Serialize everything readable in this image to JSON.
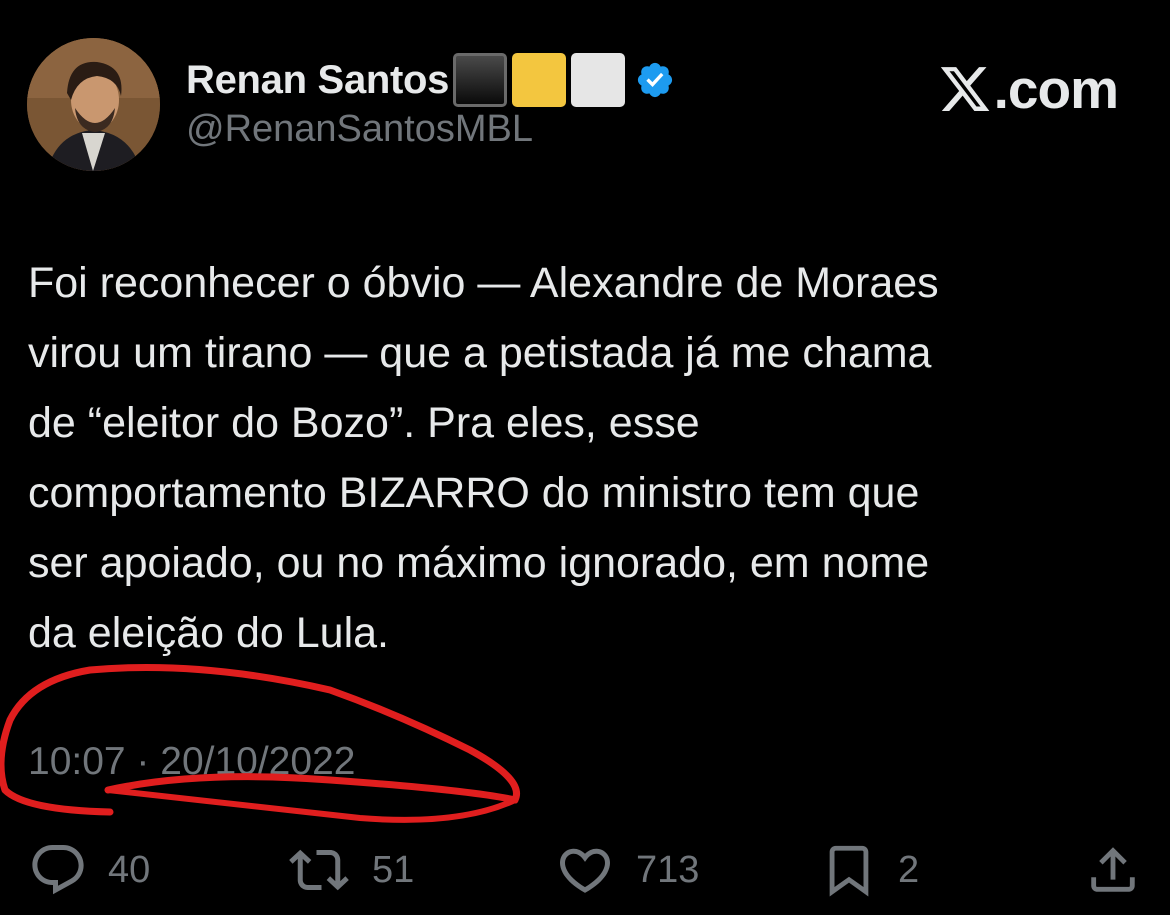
{
  "tweet": {
    "author_name": "Renan Santos",
    "author_handle": "@RenanSantosMBL",
    "name_emojis": [
      "black-square-emoji",
      "yellow-square-emoji",
      "white-square-emoji"
    ],
    "text_lines": [
      "Foi reconhecer o óbvio — Alexandre de Moraes",
      "virou um tirano — que a petistada já me chama",
      "de “eleitor do Bozo”. Pra eles, esse",
      "comportamento BIZARRO do ministro tem que",
      "ser apoiado, ou no máximo ignorado, em nome",
      "da eleição do Lula."
    ],
    "timestamp": "10:07 · 20/10/2022"
  },
  "brand": {
    "label": ".com",
    "icon": "x-logo-icon"
  },
  "actions": {
    "replies": "40",
    "reposts": "51",
    "likes": "713",
    "bookmarks": "2"
  },
  "colors": {
    "background": "#000000",
    "text": "#e7e9ea",
    "secondary": "#71767b",
    "verified": "#1d9bf0",
    "annotation": "#e01e1e"
  }
}
